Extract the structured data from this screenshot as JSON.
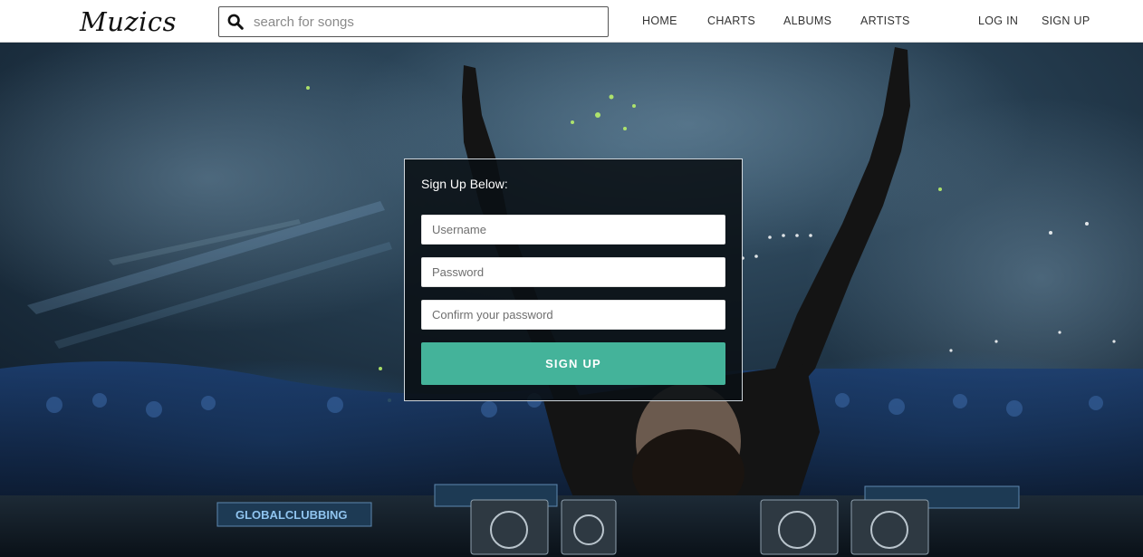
{
  "brand": {
    "name": "Muzics"
  },
  "search": {
    "placeholder": "search for songs",
    "icon": "search-icon"
  },
  "nav": {
    "home": "HOME",
    "charts": "CHARTS",
    "albums": "ALBUMS",
    "artists": "ARTISTS",
    "login": "LOG IN",
    "signup": "SIGN UP"
  },
  "signup_form": {
    "title": "Sign Up Below:",
    "username_placeholder": "Username",
    "password_placeholder": "Password",
    "confirm_placeholder": "Confirm your password",
    "submit_label": "SIGN UP"
  },
  "hero": {
    "banner_text": "GLOBALCLUBBING",
    "description_hidden": false
  },
  "colors": {
    "accent": "#44b39a",
    "navbar_bg": "#ffffff",
    "panel_bg": "#0a1014"
  }
}
